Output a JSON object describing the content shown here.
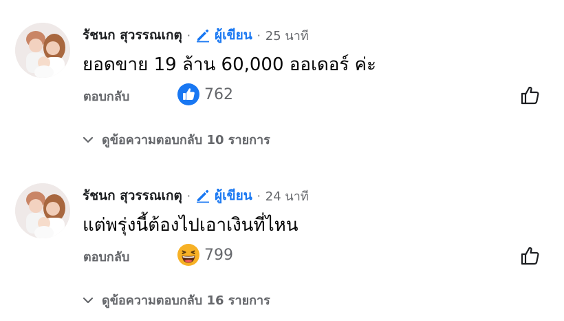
{
  "comments": [
    {
      "author": "รัชนก สุวรรณเกตุ",
      "separator": "·",
      "badge_label": "ผู้เขียน",
      "time": "25 นาที",
      "text": "ยอดขาย 19 ล้าน 60,000 ออเดอร์ ค่ะ",
      "reply_label": "ตอบกลับ",
      "reaction_icon": "like-icon",
      "reaction_count": "762",
      "view_replies": "ดูข้อความตอบกลับ 10 รายการ"
    },
    {
      "author": "รัชนก สุวรรณเกตุ",
      "separator": "·",
      "badge_label": "ผู้เขียน",
      "time": "24 นาที",
      "text": "แต่พรุ่งนี้ต้องไปเอาเงินที่ไหน",
      "reply_label": "ตอบกลับ",
      "reaction_icon": "haha-icon",
      "reaction_count": "799",
      "view_replies": "ดูข้อความตอบกลับ 16 รายการ"
    }
  ],
  "colors": {
    "brand_blue": "#1877f2",
    "secondary_text": "#65676b",
    "haha_yellow": "#f7b125"
  }
}
